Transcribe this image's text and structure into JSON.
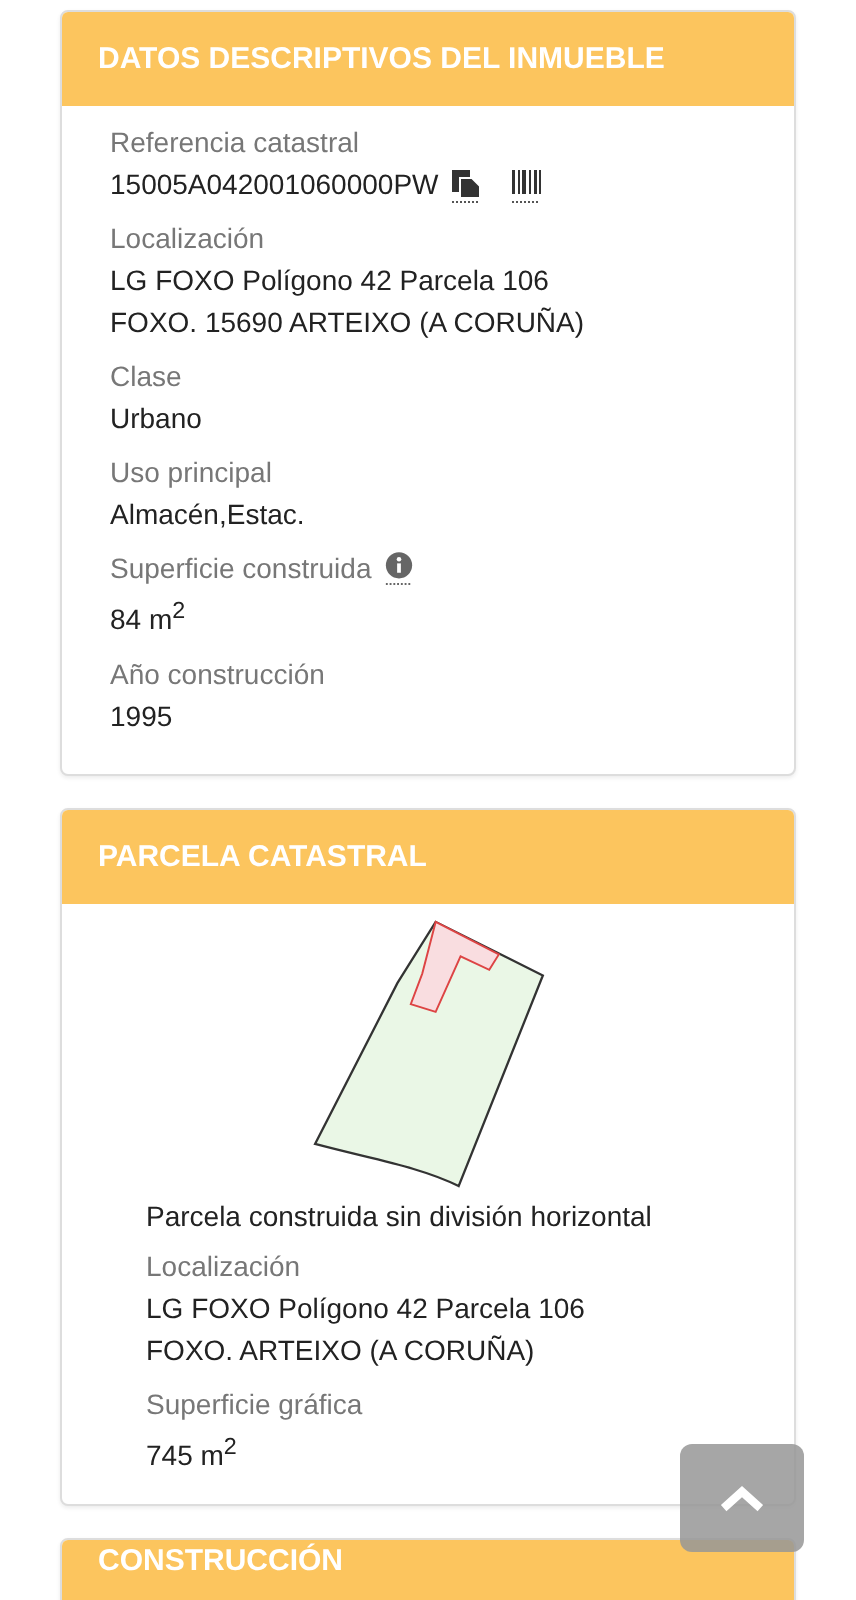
{
  "sections": [
    {
      "title": "DATOS DESCRIPTIVOS DEL INMUEBLE",
      "kind": "fields",
      "fields": [
        {
          "label": "Referencia catastral",
          "value": "15005A042001060000PW",
          "kind": "reference"
        },
        {
          "label": "Localización",
          "value": "LG FOXO Polígono 42 Parcela 106\nFOXO. 15690 ARTEIXO (A CORUÑA)",
          "kind": "plain"
        },
        {
          "label": "Clase",
          "value": "Urbano",
          "kind": "plain"
        },
        {
          "label": "Uso principal",
          "value": "Almacén,Estac.",
          "kind": "plain"
        },
        {
          "label": "Superficie construida",
          "value": "84 m$^{2}$",
          "kind": "info"
        },
        {
          "label": "Año construcción",
          "value": "1995",
          "kind": "plain"
        }
      ]
    },
    {
      "title": "PARCELA CATASTRAL",
      "kind": "parcel",
      "caption": "Parcela construida sin división horizontal",
      "fields": [
        {
          "label": "Localización",
          "value": "LG FOXO Polígono 42 Parcela 106\nFOXO. ARTEIXO (A CORUÑA)"
        },
        {
          "label": "Superficie gráfica",
          "value": "745 m$^{2}$"
        }
      ]
    },
    {
      "title": "CONSTRUCCIÓN",
      "kind": "fields"
    }
  ]
}
